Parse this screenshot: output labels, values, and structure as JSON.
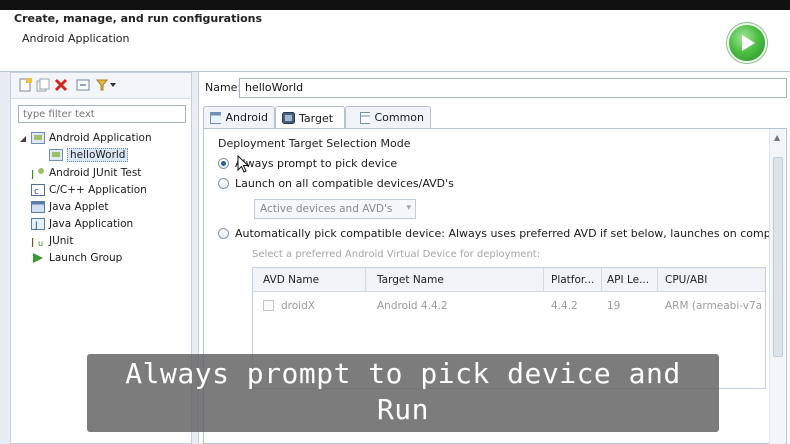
{
  "dialog": {
    "title": "Create, manage, and run configurations",
    "subtitle": "Android Application"
  },
  "left_panel": {
    "filter_placeholder": "type filter text",
    "tree": [
      {
        "label": "Android Application",
        "icon": "android-app-icon",
        "expanded": true
      },
      {
        "label": "helloWorld",
        "icon": "config-icon",
        "selected": true
      },
      {
        "label": "Android JUnit Test",
        "icon": "junit-android-icon"
      },
      {
        "label": "C/C++ Application",
        "icon": "c-app-icon"
      },
      {
        "label": "Java Applet",
        "icon": "applet-icon"
      },
      {
        "label": "Java Application",
        "icon": "java-app-icon"
      },
      {
        "label": "JUnit",
        "icon": "junit-icon"
      },
      {
        "label": "Launch Group",
        "icon": "launch-group-icon"
      }
    ]
  },
  "right_panel": {
    "name_label": "Name:",
    "name_value": "helloWorld",
    "tabs": [
      {
        "label": "Android",
        "active": false
      },
      {
        "label": "Target",
        "active": true
      },
      {
        "label": "Common",
        "active": false
      }
    ],
    "group_title": "Deployment Target Selection Mode",
    "radios": [
      {
        "label": "Always prompt to pick device",
        "checked": true
      },
      {
        "label": "Launch on all compatible devices/AVD's",
        "checked": false
      },
      {
        "label": "Automatically pick compatible device: Always uses preferred AVD if set below, launches on compati",
        "checked": false
      }
    ],
    "combo_value": "Active devices and AVD's",
    "table_hint": "Select a preferred Android Virtual Device for deployment:",
    "table": {
      "headers": [
        "AVD Name",
        "Target Name",
        "Platfor...",
        "API Le...",
        "CPU/ABI"
      ],
      "rows": [
        [
          "droidX",
          "Android 4.4.2",
          "4.4.2",
          "19",
          "ARM (armeabi-v7a"
        ]
      ]
    }
  },
  "caption": {
    "line1": "Always prompt to pick device and",
    "line2": "Run"
  },
  "colors": {
    "accent": "#2b5ea8",
    "run_green": "#4dbf45",
    "caption_bg": "#5f5f5f"
  }
}
